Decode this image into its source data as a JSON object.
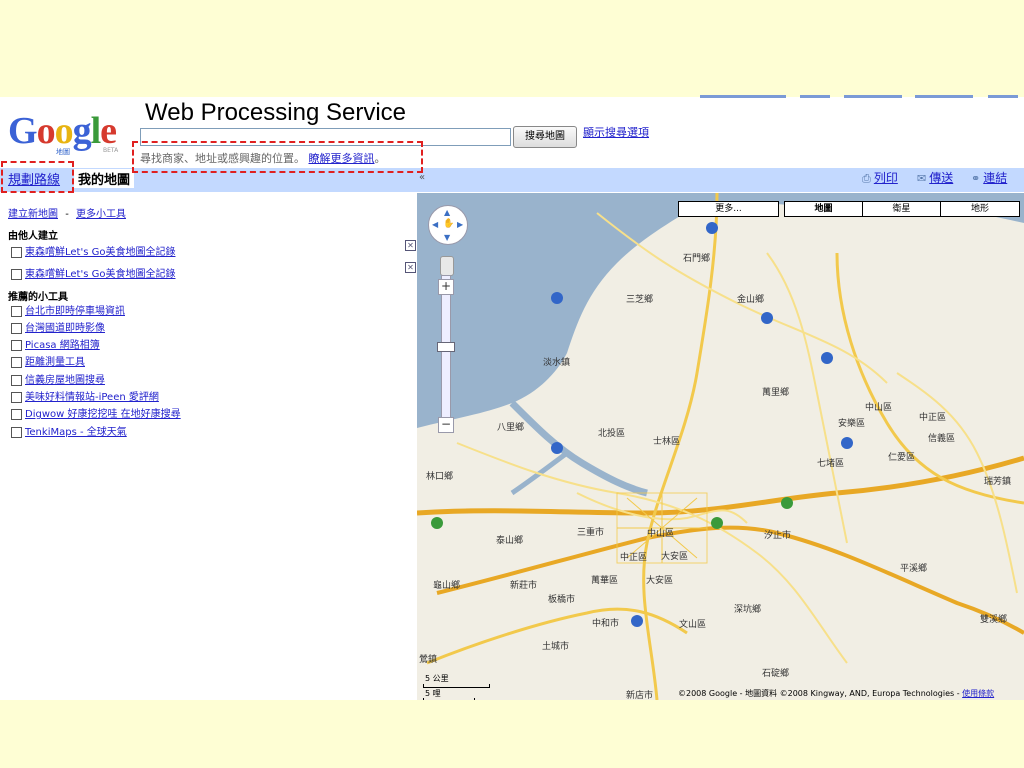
{
  "slide_title": "Web Processing Service",
  "header": {
    "search_placeholder": "",
    "search_button": "搜尋地圖",
    "search_options_link": "顯示搜尋選項",
    "hint_text": "尋找商家、地址或感興趣的位置。",
    "hint_link": "瞭解更多資訊",
    "hint_tail": "。"
  },
  "tabs": {
    "directions": "規劃路線",
    "my_maps": "我的地圖",
    "collapse": "«"
  },
  "tools": {
    "print": "列印",
    "send": "傳送",
    "link": "連結"
  },
  "sidebar": {
    "create_map": "建立新地圖",
    "separator": "-",
    "more_gadgets": "更多小工具",
    "section_created": "由他人建立",
    "created_items": [
      "東森嚐鮮Let's Go美食地圖全記錄",
      "東森嚐鮮Let's Go美食地圖全記錄"
    ],
    "section_featured": "推薦的小工具",
    "featured_items": [
      "台北市即時停車場資訊",
      "台灣國道即時影像",
      "Picasa 網路相簿",
      "距離測量工具",
      "信義房屋地圖搜尋",
      "美味好料情報站-iPeen 愛評網",
      "Digwow 好康挖挖哇 在地好康搜尋",
      "TenkiMaps - 全球天氣"
    ]
  },
  "map": {
    "map_types": [
      "更多...",
      "地圖",
      "衛星",
      "地形"
    ],
    "selected_type": "地圖",
    "places": [
      "石門鄉",
      "三芝鄉",
      "金山鄉",
      "淡水鎮",
      "萬里鄉",
      "八里鄉",
      "北投區",
      "士林區",
      "中山區",
      "安樂區",
      "中正區",
      "信義區",
      "林口鄉",
      "七堵區",
      "仁愛區",
      "瑞芳鎮",
      "泰山鄉",
      "三重市",
      "中山區",
      "汐止市",
      "中正區",
      "大安區",
      "龜山鄉",
      "新莊市",
      "萬華區",
      "大安區",
      "平溪鄉",
      "板橋市",
      "深坑鄉",
      "中和市",
      "文山區",
      "雙溪鄉",
      "土城市",
      "石碇鄉",
      "新店市",
      "鶯鎮"
    ],
    "scale_top": "5 公里",
    "scale_bottom": "5 哩",
    "copyright": "©2008 Google - 地圖資料 ©2008 Kingway, AND, Europa Technologies - ",
    "terms_link": "使用條款"
  },
  "colors": {
    "slide_bg": "#fefed4",
    "tabbar": "#c3d9ff",
    "link": "#2222cc",
    "highlight_dash": "#e02020",
    "map_land": "#f1eee4",
    "map_water": "#99b3cc",
    "road_major": "#f2c94c",
    "road_minor": "#f7e08a"
  }
}
